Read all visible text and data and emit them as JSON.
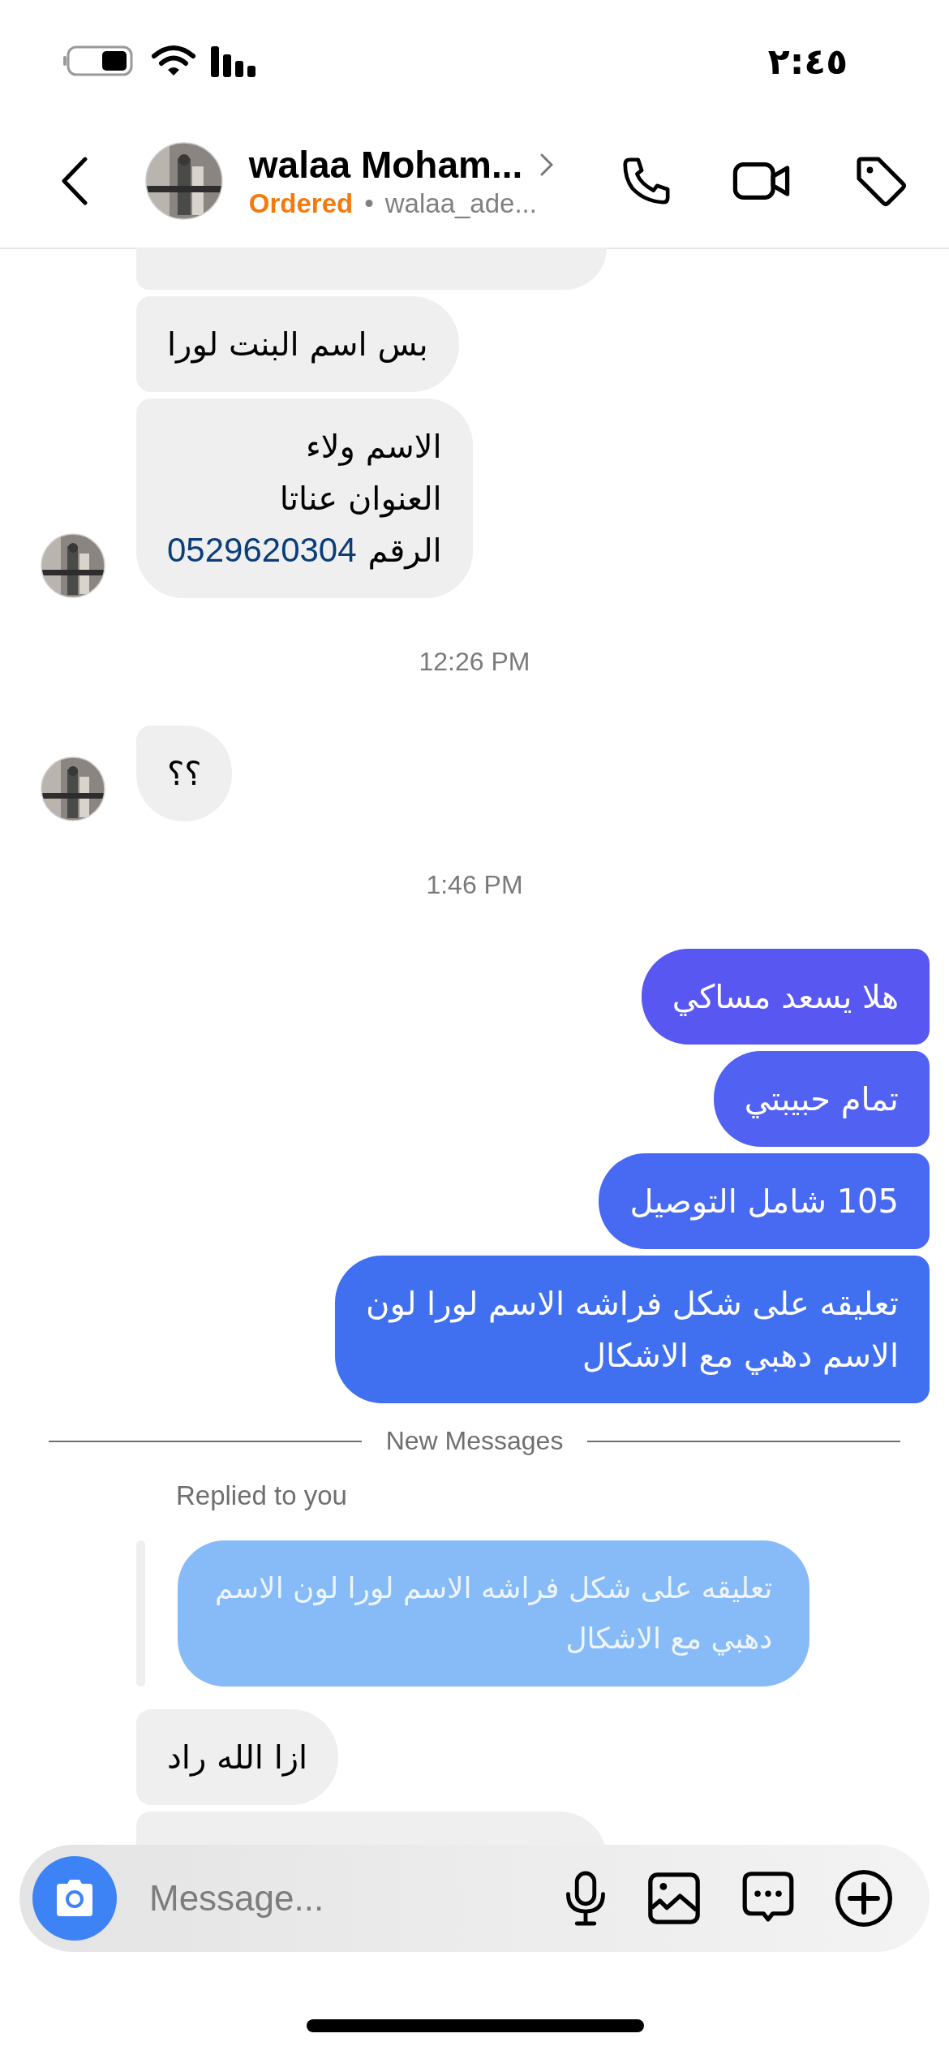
{
  "status_bar": {
    "time": "٢:٤٥"
  },
  "header": {
    "name": "walaa Moham...",
    "status": "Ordered",
    "separator": "•",
    "username": "walaa_ade..."
  },
  "messages": [
    {
      "kind": "clipped"
    },
    {
      "kind": "in",
      "avatar": false,
      "lines": [
        "بس اسم البنت لورا"
      ]
    },
    {
      "kind": "in",
      "avatar": true,
      "lines": [
        "الاسم ولاء",
        "العنوان عناتا",
        "الرقم"
      ],
      "phone": "0529620304"
    },
    {
      "kind": "time",
      "text": "12:26 PM"
    },
    {
      "kind": "in",
      "avatar": true,
      "lines": [
        "؟؟"
      ]
    },
    {
      "kind": "time",
      "text": "1:46 PM"
    },
    {
      "kind": "out",
      "color": "#5857f1",
      "lines": [
        "هلا يسعد مساكي"
      ]
    },
    {
      "kind": "out",
      "color": "#5161f1",
      "lines": [
        "تمام حبيبتي"
      ]
    },
    {
      "kind": "out",
      "color": "#4869f1",
      "lines": [
        "105 شامل التوصيل"
      ]
    },
    {
      "kind": "out",
      "color": "#406ff0",
      "lines": [
        "تعليقه على شكل فراشه الاسم لورا لون",
        "الاسم دهبي مع الاشكال"
      ]
    },
    {
      "kind": "divider",
      "text": "New Messages"
    },
    {
      "kind": "reply_label",
      "text": "Replied to you"
    },
    {
      "kind": "quote",
      "lines": [
        "تعليقه على شكل فراشه الاسم لورا لون الاسم",
        "دهبي مع الاشكال"
      ]
    },
    {
      "kind": "in",
      "avatar": false,
      "lines": [
        "ازا الله راد"
      ]
    },
    {
      "kind": "hidden"
    }
  ],
  "composer": {
    "placeholder": "Message..."
  }
}
